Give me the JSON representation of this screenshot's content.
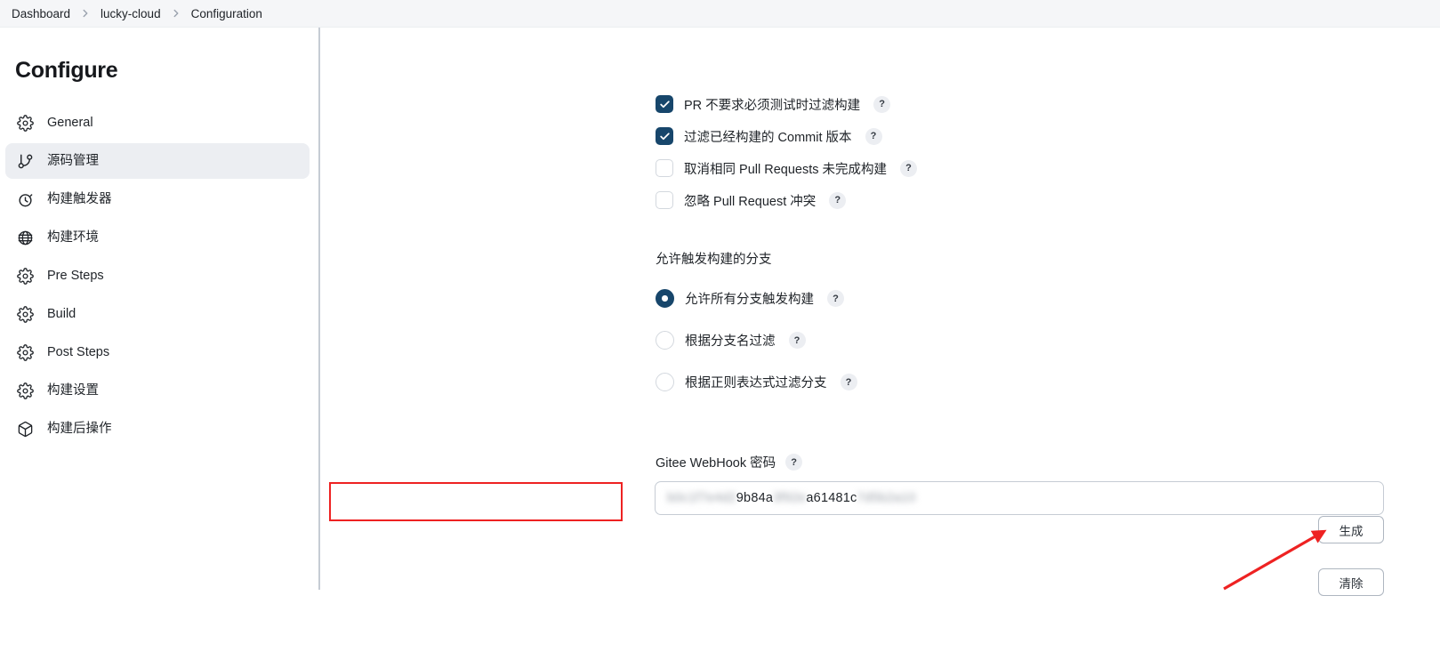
{
  "breadcrumb": {
    "items": [
      {
        "label": "Dashboard"
      },
      {
        "label": "lucky-cloud"
      },
      {
        "label": "Configuration"
      }
    ]
  },
  "sidebar": {
    "title": "Configure",
    "items": [
      {
        "label": "General",
        "icon": "gear-icon",
        "active": false
      },
      {
        "label": "源码管理",
        "icon": "git-branch-icon",
        "active": true
      },
      {
        "label": "构建触发器",
        "icon": "timer-icon",
        "active": false
      },
      {
        "label": "构建环境",
        "icon": "globe-icon",
        "active": false
      },
      {
        "label": "Pre Steps",
        "icon": "gear-icon",
        "active": false
      },
      {
        "label": "Build",
        "icon": "gear-icon",
        "active": false
      },
      {
        "label": "Post Steps",
        "icon": "gear-icon",
        "active": false
      },
      {
        "label": "构建设置",
        "icon": "gear-icon",
        "active": false
      },
      {
        "label": "构建后操作",
        "icon": "package-icon",
        "active": false
      }
    ]
  },
  "main": {
    "checkboxes": [
      {
        "label": "PR 不要求必须测试时过滤构建",
        "checked": true,
        "help": "?"
      },
      {
        "label": "过滤已经构建的 Commit 版本",
        "checked": true,
        "help": "?"
      },
      {
        "label": "取消相同 Pull Requests 未完成构建",
        "checked": false,
        "help": "?"
      },
      {
        "label": "忽略 Pull Request 冲突",
        "checked": false,
        "help": "?"
      }
    ],
    "radio_group": {
      "heading": "允许触发构建的分支",
      "options": [
        {
          "label": "允许所有分支触发构建",
          "selected": true,
          "help": "?"
        },
        {
          "label": "根据分支名过滤",
          "selected": false,
          "help": "?"
        },
        {
          "label": "根据正则表达式过滤分支",
          "selected": false,
          "help": "?"
        }
      ]
    },
    "webhook": {
      "label": "Gitee WebHook 密码",
      "help": "?",
      "value_visible_1": "9b84a",
      "value_visible_2": "a61481c",
      "value_masked_1": "b0c1f7e4d2",
      "value_masked_2": "3f92e",
      "value_masked_3": "7d5b2a10",
      "placeholder": ""
    },
    "buttons": {
      "generate": "生成",
      "clear": "清除"
    }
  },
  "colors": {
    "accent": "#17466b",
    "annotation": "#ee2222",
    "sidebar_active_bg": "#eceef2",
    "breadcrumb_bg": "#f5f6f8",
    "border": "#c6ccd4"
  }
}
